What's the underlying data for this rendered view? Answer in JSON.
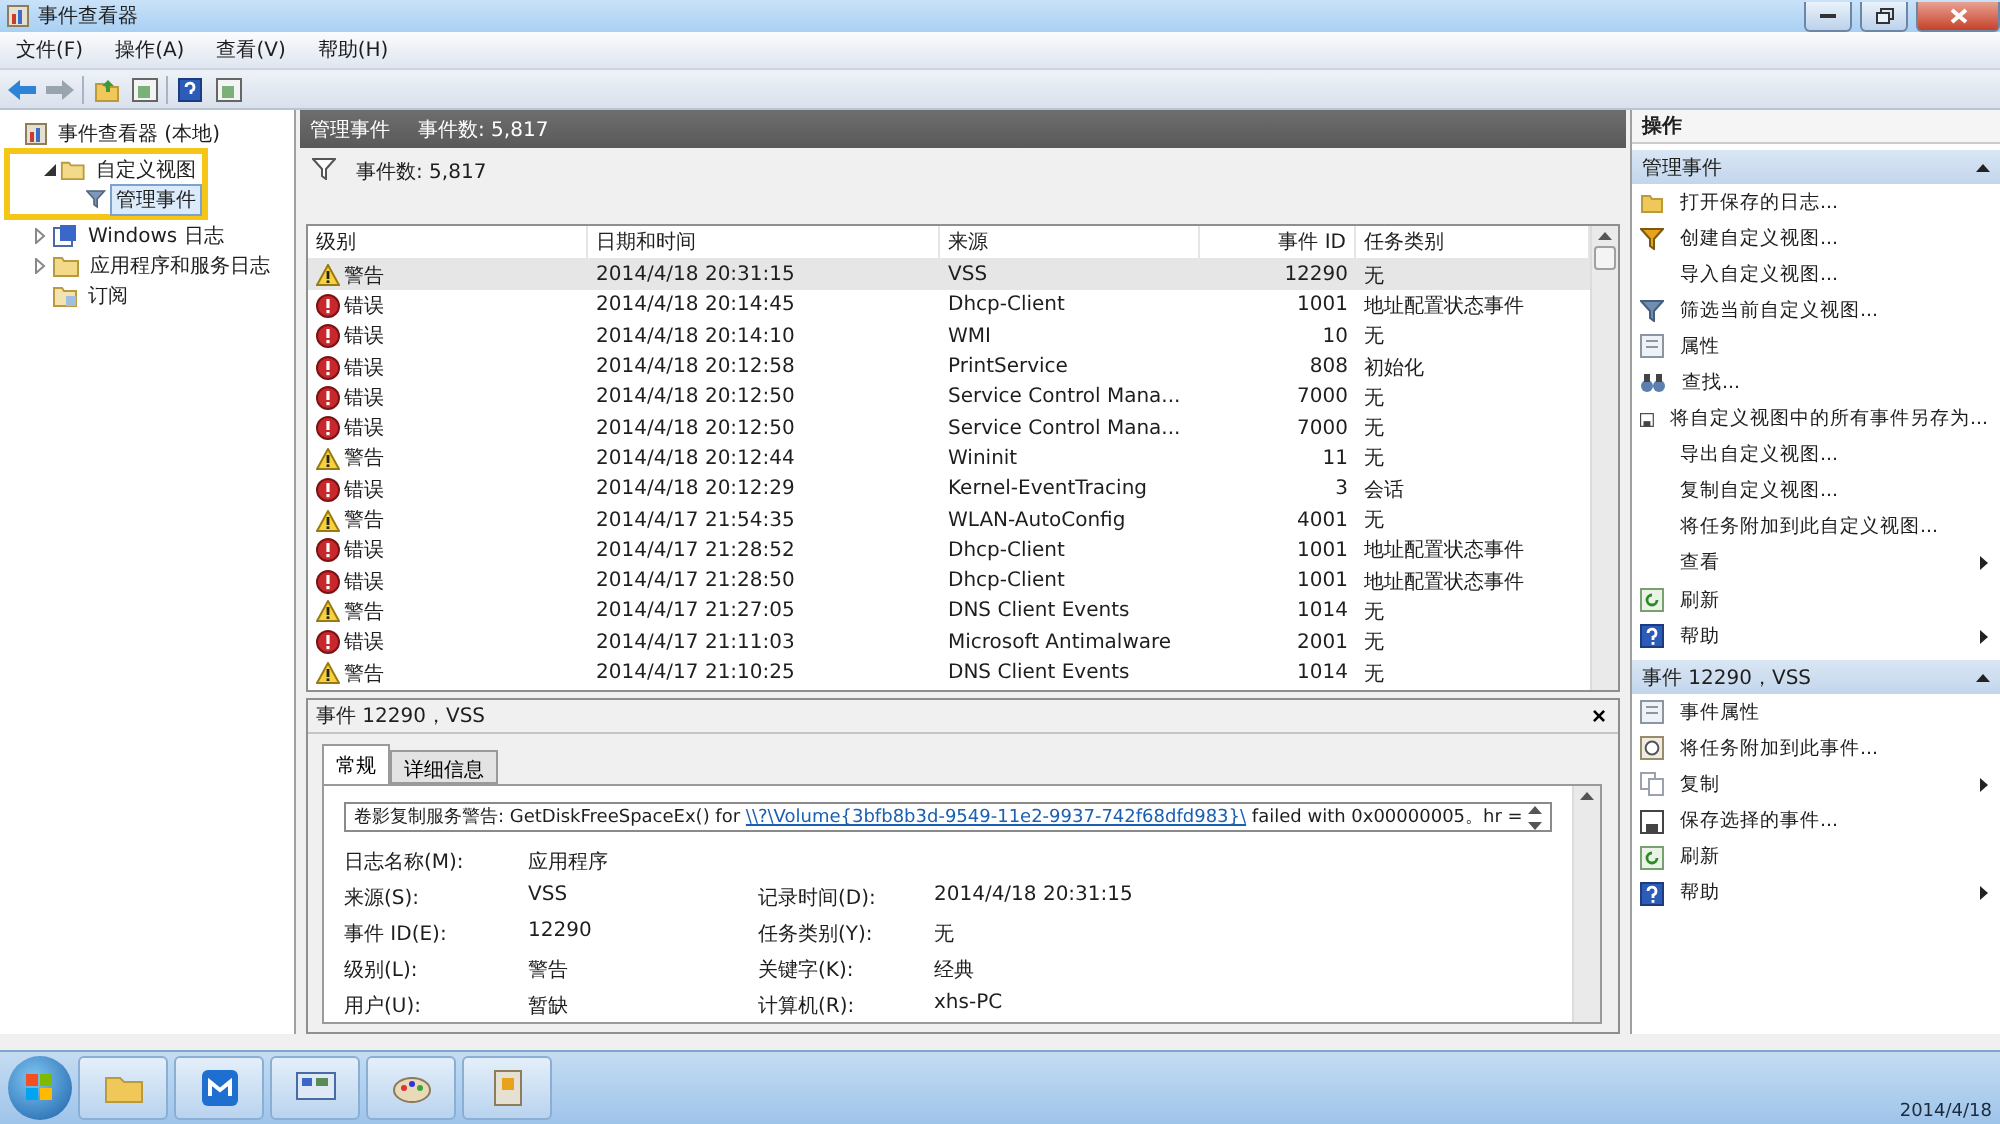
{
  "window": {
    "title": "事件查看器"
  },
  "menu": [
    "文件(F)",
    "操作(A)",
    "查看(V)",
    "帮助(H)"
  ],
  "tree": [
    {
      "label": "事件查看器 (本地)",
      "kind": "root",
      "selected": false,
      "children": [
        {
          "label": "自定义视图",
          "kind": "folder",
          "selected": false,
          "expanded": true,
          "highlighted": true,
          "children": [
            {
              "label": "管理事件",
              "kind": "filter",
              "selected": true
            }
          ]
        },
        {
          "label": "Windows 日志",
          "kind": "logs",
          "selected": false,
          "expanded": false
        },
        {
          "label": "应用程序和服务日志",
          "kind": "folder",
          "selected": false,
          "expanded": false
        },
        {
          "label": "订阅",
          "kind": "subscription",
          "selected": false
        }
      ]
    }
  ],
  "center": {
    "title": "管理事件",
    "count": "事件数: 5,817",
    "filter_count": "事件数: 5,817"
  },
  "table": {
    "columns": [
      "级别",
      "日期和时间",
      "来源",
      "事件 ID",
      "任务类别"
    ],
    "rows": [
      {
        "kind": "warning",
        "level": "警告",
        "time": "2014/4/18 20:31:15",
        "source": "VSS",
        "id": "12290",
        "task": "无",
        "selected": true
      },
      {
        "kind": "error",
        "level": "错误",
        "time": "2014/4/18 20:14:45",
        "source": "Dhcp-Client",
        "id": "1001",
        "task": "地址配置状态事件",
        "selected": false
      },
      {
        "kind": "error",
        "level": "错误",
        "time": "2014/4/18 20:14:10",
        "source": "WMI",
        "id": "10",
        "task": "无",
        "selected": false
      },
      {
        "kind": "error",
        "level": "错误",
        "time": "2014/4/18 20:12:58",
        "source": "PrintService",
        "id": "808",
        "task": "初始化",
        "selected": false
      },
      {
        "kind": "error",
        "level": "错误",
        "time": "2014/4/18 20:12:50",
        "source": "Service Control Mana...",
        "id": "7000",
        "task": "无",
        "selected": false
      },
      {
        "kind": "error",
        "level": "错误",
        "time": "2014/4/18 20:12:50",
        "source": "Service Control Mana...",
        "id": "7000",
        "task": "无",
        "selected": false
      },
      {
        "kind": "warning",
        "level": "警告",
        "time": "2014/4/18 20:12:44",
        "source": "Wininit",
        "id": "11",
        "task": "无",
        "selected": false
      },
      {
        "kind": "error",
        "level": "错误",
        "time": "2014/4/18 20:12:29",
        "source": "Kernel-EventTracing",
        "id": "3",
        "task": "会话",
        "selected": false
      },
      {
        "kind": "warning",
        "level": "警告",
        "time": "2014/4/17 21:54:35",
        "source": "WLAN-AutoConfig",
        "id": "4001",
        "task": "无",
        "selected": false
      },
      {
        "kind": "error",
        "level": "错误",
        "time": "2014/4/17 21:28:52",
        "source": "Dhcp-Client",
        "id": "1001",
        "task": "地址配置状态事件",
        "selected": false
      },
      {
        "kind": "error",
        "level": "错误",
        "time": "2014/4/17 21:28:50",
        "source": "Dhcp-Client",
        "id": "1001",
        "task": "地址配置状态事件",
        "selected": false
      },
      {
        "kind": "warning",
        "level": "警告",
        "time": "2014/4/17 21:27:05",
        "source": "DNS Client Events",
        "id": "1014",
        "task": "无",
        "selected": false
      },
      {
        "kind": "error",
        "level": "错误",
        "time": "2014/4/17 21:11:03",
        "source": "Microsoft Antimalware",
        "id": "2001",
        "task": "无",
        "selected": false
      },
      {
        "kind": "warning",
        "level": "警告",
        "time": "2014/4/17 21:10:25",
        "source": "DNS Client Events",
        "id": "1014",
        "task": "无",
        "selected": false
      }
    ]
  },
  "detail": {
    "title": "事件 12290，VSS",
    "close": "×",
    "tabs": [
      {
        "label": "常规",
        "selected": true
      },
      {
        "label": "详细信息",
        "selected": false
      }
    ],
    "message": {
      "prefix": "卷影复制服务警告: GetDiskFreeSpaceEx() for ",
      "link": "\\\\?\\Volume{3bfb8b3d-9549-11e2-9937-742f68dfd983}\\",
      "suffix": " failed with 0x00000005。hr ="
    },
    "fields": [
      {
        "label": "日志名称(M):",
        "value": "应用程序"
      },
      {
        "label": "来源(S):",
        "value": "VSS",
        "label2": "记录时间(D):",
        "value2": "2014/4/18 20:31:15"
      },
      {
        "label": "事件 ID(E):",
        "value": "12290",
        "label2": "任务类别(Y):",
        "value2": "无"
      },
      {
        "label": "级别(L):",
        "value": "警告",
        "label2": "关键字(K):",
        "value2": "经典"
      },
      {
        "label": "用户(U):",
        "value": "暂缺",
        "label2": "计算机(R):",
        "value2": "xhs-PC"
      }
    ]
  },
  "actions": {
    "title": "操作",
    "sections": [
      {
        "title": "管理事件",
        "items": [
          {
            "kind": "open",
            "label": "打开保存的日志...",
            "submenu": false
          },
          {
            "kind": "filter",
            "label": "创建自定义视图...",
            "submenu": false
          },
          {
            "kind": "plain",
            "label": "导入自定义视图...",
            "submenu": false
          },
          {
            "kind": "filter-gray",
            "label": "筛选当前自定义视图...",
            "submenu": false
          },
          {
            "kind": "properties",
            "label": "属性",
            "submenu": false
          },
          {
            "kind": "find",
            "label": "查找...",
            "submenu": false
          },
          {
            "kind": "save",
            "label": "将自定义视图中的所有事件另存为...",
            "submenu": false
          },
          {
            "kind": "plain",
            "label": "导出自定义视图...",
            "submenu": false
          },
          {
            "kind": "plain",
            "label": "复制自定义视图...",
            "submenu": false
          },
          {
            "kind": "plain",
            "label": "将任务附加到此自定义视图...",
            "submenu": false
          },
          {
            "kind": "plain",
            "label": "查看",
            "submenu": true
          },
          {
            "kind": "refresh",
            "label": "刷新",
            "submenu": false
          },
          {
            "kind": "help",
            "label": "帮助",
            "submenu": true
          }
        ]
      },
      {
        "title": "事件 12290，VSS",
        "items": [
          {
            "kind": "properties",
            "label": "事件属性",
            "submenu": false
          },
          {
            "kind": "attach",
            "label": "将任务附加到此事件...",
            "submenu": false
          },
          {
            "kind": "copy",
            "label": "复制",
            "submenu": true
          },
          {
            "kind": "save",
            "label": "保存选择的事件...",
            "submenu": false
          },
          {
            "kind": "refresh",
            "label": "刷新",
            "submenu": false
          },
          {
            "kind": "help",
            "label": "帮助",
            "submenu": true
          }
        ]
      }
    ]
  },
  "taskbar": {
    "date": "2014/4/18"
  }
}
